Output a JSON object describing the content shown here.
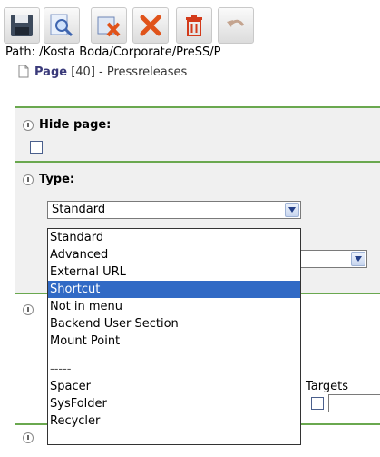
{
  "toolbar": {
    "buttons": [
      {
        "name": "save-button",
        "icon": "save-icon"
      },
      {
        "name": "view-button",
        "icon": "magnifier-icon"
      },
      {
        "name": "save-close-button",
        "icon": "save-close-icon"
      },
      {
        "name": "close-button",
        "icon": "close-icon"
      },
      {
        "name": "delete-button",
        "icon": "trash-icon"
      },
      {
        "name": "undo-button",
        "icon": "undo-icon"
      }
    ],
    "colors": {
      "close": "#e0531a",
      "delete": "#d33a1a",
      "accent_green": "#6aa84f"
    }
  },
  "path": {
    "text": "Path: /Kosta Boda/Corporate/PreSS/P"
  },
  "page_header": {
    "label": "Page",
    "rest": " [40] - Pressreleases"
  },
  "sections": {
    "hide_page": {
      "title": "Hide page:",
      "checked": false
    },
    "type": {
      "title": "Type:",
      "selected": "Standard"
    },
    "target": {
      "label": "Targets"
    }
  },
  "dropdown": {
    "items": [
      "Standard",
      "Advanced",
      "External URL",
      "Shortcut",
      "Not in menu",
      "Backend User Section",
      "Mount Point"
    ],
    "separator": "-----",
    "items2": [
      "Spacer",
      "SysFolder",
      "Recycler"
    ],
    "selected_index": 3
  }
}
